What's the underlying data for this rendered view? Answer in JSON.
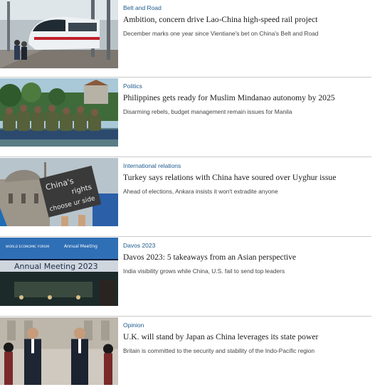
{
  "articles": [
    {
      "category": "Belt and Road",
      "headline": "Ambition, concern drive Lao-China high-speed rail project",
      "summary": "December marks one year since Vientiane's bet on China's Belt and Road",
      "image_desc": "high-speed-train-photo"
    },
    {
      "category": "Politics",
      "headline": "Philippines gets ready for Muslim Mindanao autonomy by 2025",
      "summary": "Disarming rebels, budget management remain issues for Manila",
      "image_desc": "soldiers-on-boat-photo"
    },
    {
      "category": "International relations",
      "headline": "Turkey says relations with China have soured over Uyghur issue",
      "summary": "Ahead of elections, Ankara insists it won't extradite anyone",
      "image_desc": "protest-sign-photo",
      "image_sign_text": [
        "China's",
        "rights",
        "choose ur side"
      ]
    },
    {
      "category": "Davos 2023",
      "headline": "Davos 2023: 5 takeaways from an Asian perspective",
      "summary": "India visibility grows while China, U.S. fail to send top leaders",
      "image_desc": "annual-meeting-hall-photo",
      "image_banner_text": "Annual Meeting 2023",
      "image_logo_text": "WORLD ECONOMIC FORUM",
      "image_logo_subtext": "Annual Meeting"
    },
    {
      "category": "Opinion",
      "headline": "U.K. will stand by Japan as China leverages its state power",
      "summary": "Britain is committed to the security and stability of the Indo-Pacific region",
      "image_desc": "leaders-walking-photo"
    }
  ]
}
